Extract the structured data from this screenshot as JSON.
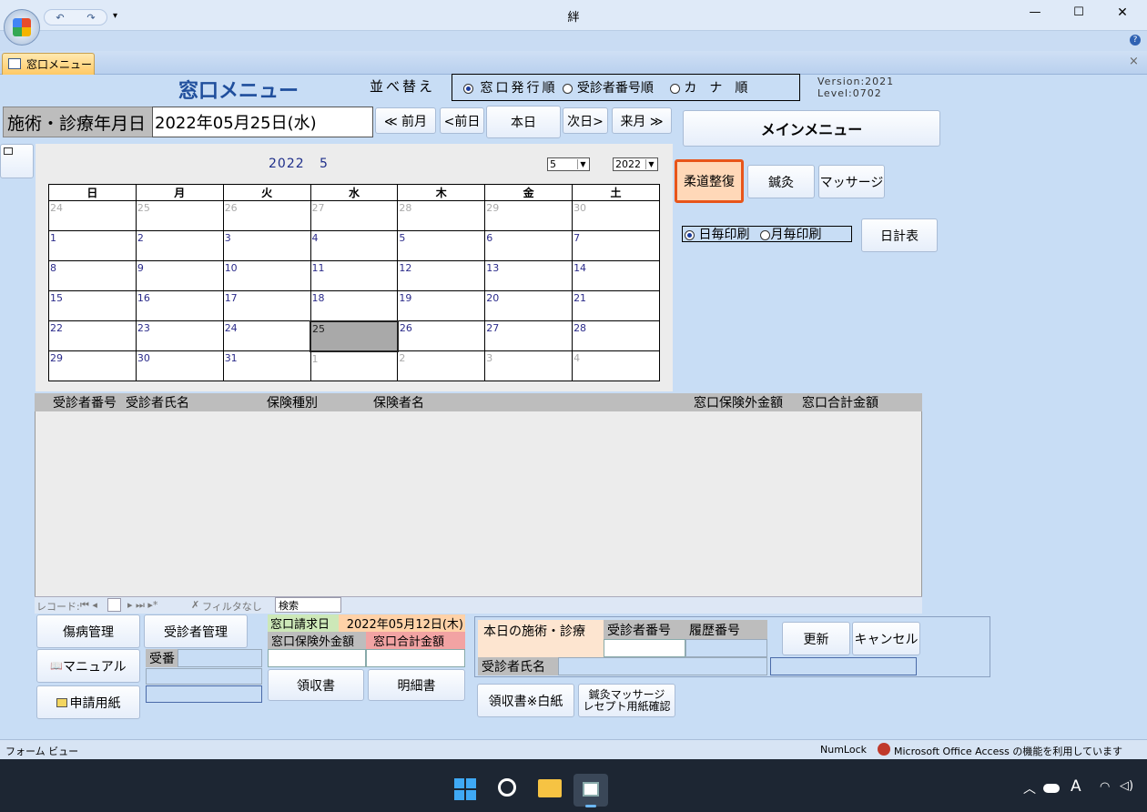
{
  "window": {
    "title": "絆",
    "min": "—",
    "max": "☐",
    "close": "✕",
    "help": "?"
  },
  "tab": {
    "label": "窓口メニュー",
    "close": "×"
  },
  "header": {
    "form_title": "窓口メニュー",
    "sort_label": "並べ替え",
    "sort_options": [
      "窓口発行順",
      "受診者番号順",
      "カ　ナ　順"
    ],
    "version": "Version:2021",
    "level": "Level:0702"
  },
  "date": {
    "label": "施術・診療年月日",
    "value": "2022年05月25日(水)"
  },
  "nav": {
    "prev_month": "≪ 前月",
    "prev_day": "<前日",
    "today": "本日",
    "next_day": "次日>",
    "next_month": "来月 ≫"
  },
  "main_menu": "メインメニュー",
  "types": {
    "judo": "柔道整復",
    "acu": "鍼灸",
    "massage": "マッサージ"
  },
  "print": {
    "daily": "日毎印刷",
    "monthly": "月毎印刷",
    "daily_report": "日計表"
  },
  "calendar": {
    "year": "2022",
    "month": "5",
    "month_select": "5",
    "year_select": "2022",
    "weekdays": [
      "日",
      "月",
      "火",
      "水",
      "木",
      "金",
      "土"
    ],
    "weeks": [
      [
        {
          "d": "24",
          "o": 1
        },
        {
          "d": "25",
          "o": 1
        },
        {
          "d": "26",
          "o": 1
        },
        {
          "d": "27",
          "o": 1
        },
        {
          "d": "28",
          "o": 1
        },
        {
          "d": "29",
          "o": 1
        },
        {
          "d": "30",
          "o": 1
        }
      ],
      [
        {
          "d": "1"
        },
        {
          "d": "2"
        },
        {
          "d": "3"
        },
        {
          "d": "4"
        },
        {
          "d": "5"
        },
        {
          "d": "6"
        },
        {
          "d": "7"
        }
      ],
      [
        {
          "d": "8"
        },
        {
          "d": "9"
        },
        {
          "d": "10"
        },
        {
          "d": "11"
        },
        {
          "d": "12"
        },
        {
          "d": "13"
        },
        {
          "d": "14"
        }
      ],
      [
        {
          "d": "15"
        },
        {
          "d": "16"
        },
        {
          "d": "17"
        },
        {
          "d": "18"
        },
        {
          "d": "19"
        },
        {
          "d": "20"
        },
        {
          "d": "21"
        }
      ],
      [
        {
          "d": "22"
        },
        {
          "d": "23"
        },
        {
          "d": "24"
        },
        {
          "d": "25",
          "s": 1
        },
        {
          "d": "26"
        },
        {
          "d": "27"
        },
        {
          "d": "28"
        }
      ],
      [
        {
          "d": "29"
        },
        {
          "d": "30"
        },
        {
          "d": "31"
        },
        {
          "d": "1",
          "o": 1
        },
        {
          "d": "2",
          "o": 1
        },
        {
          "d": "3",
          "o": 1
        },
        {
          "d": "4",
          "o": 1
        }
      ]
    ]
  },
  "list": {
    "headers": [
      "受診者番号",
      "受診者氏名",
      "保険種別",
      "保険者名",
      "窓口保険外金額",
      "窓口合計金額"
    ]
  },
  "navbar": {
    "record": "レコード:",
    "nofilter": "フィルタなし",
    "search": "検索"
  },
  "bottom": {
    "injury": "傷病管理",
    "patient": "受診者管理",
    "manual": "マニュアル",
    "form": "申請用紙",
    "receipt_no": "受番",
    "claim_date_label": "窓口請求日",
    "claim_date": "2022年05月12日(木)",
    "ext_amount": "窓口保険外金額",
    "total_amount": "窓口合計金額",
    "receipt": "領収書",
    "detail": "明細書",
    "today_treat": "本日の施術・診療",
    "patient_no": "受診者番号",
    "history_no": "履歴番号",
    "patient_name": "受診者氏名",
    "update": "更新",
    "cancel": "キャンセル",
    "receipt_blank": "領収書※白紙",
    "receipt_check": "鍼灸マッサージ\nレセプト用紙確認"
  },
  "status": {
    "view": "フォーム ビュー",
    "numlock": "NumLock",
    "access": "Microsoft Office Access の機能を利用しています"
  },
  "colors": {
    "bg": "#c8ddf5",
    "title_blue": "#1f4e9c",
    "accent_orange": "#e8551a"
  }
}
